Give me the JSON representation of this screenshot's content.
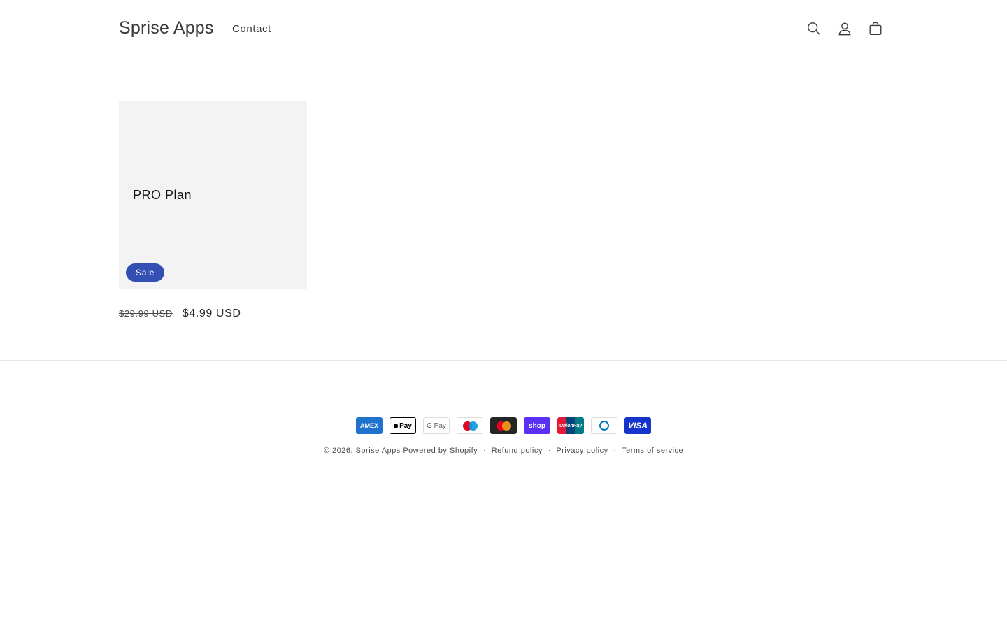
{
  "header": {
    "brand": "Sprise Apps",
    "nav": [
      "Contact"
    ],
    "icons": [
      "search-icon",
      "account-icon",
      "cart-icon"
    ]
  },
  "product": {
    "title": "PRO Plan",
    "badge": "Sale",
    "price_regular": "$29.99 USD",
    "price_sale": "$4.99 USD"
  },
  "footer": {
    "payments": [
      {
        "name": "amex",
        "label": "AMEX"
      },
      {
        "name": "apple-pay",
        "label": "Pay"
      },
      {
        "name": "google-pay",
        "label": "G Pay"
      },
      {
        "name": "maestro",
        "label": ""
      },
      {
        "name": "mastercard",
        "label": ""
      },
      {
        "name": "shop-pay",
        "label": "shop"
      },
      {
        "name": "union-pay",
        "label": "UnionPay"
      },
      {
        "name": "diners-club",
        "label": ""
      },
      {
        "name": "visa",
        "label": "VISA"
      }
    ],
    "copyright_prefix": "© 2026,",
    "copyright_brand": "Sprise Apps",
    "powered": "Powered by Shopify",
    "policies": [
      "Refund policy",
      "Privacy policy",
      "Terms of service"
    ],
    "separator": "·"
  },
  "colors": {
    "badge": "#334fb4",
    "card_bg": "#f3f3f3"
  }
}
